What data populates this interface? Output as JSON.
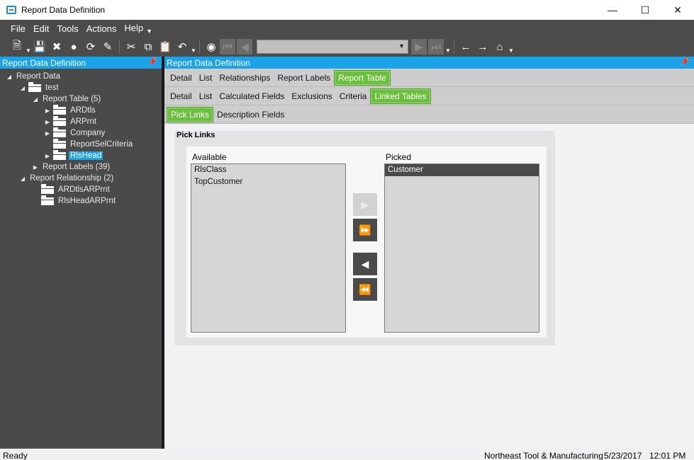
{
  "window": {
    "title": "Report Data Definition"
  },
  "menu": [
    "File",
    "Edit",
    "Tools",
    "Actions",
    "Help"
  ],
  "left_panel": {
    "title": "Report Data Definition",
    "tree": [
      {
        "label": "Report Data",
        "depth": 0,
        "expander": "expanded",
        "folder": false
      },
      {
        "label": "test",
        "depth": 1,
        "expander": "expanded",
        "folder": true
      },
      {
        "label": "Report Table (5)",
        "depth": 2,
        "expander": "expanded",
        "folder": false
      },
      {
        "label": "ARDtls",
        "depth": 3,
        "expander": "collapsed",
        "folder": true
      },
      {
        "label": "ARPrnt",
        "depth": 3,
        "expander": "collapsed",
        "folder": true
      },
      {
        "label": "Company",
        "depth": 3,
        "expander": "collapsed",
        "folder": true
      },
      {
        "label": "ReportSelCriteria",
        "depth": 3,
        "expander": "none",
        "folder": true
      },
      {
        "label": "RlsHead",
        "depth": 3,
        "expander": "collapsed",
        "folder": true,
        "selected": true
      },
      {
        "label": "Report Labels (39)",
        "depth": 2,
        "expander": "collapsed",
        "folder": false
      },
      {
        "label": "Report Relationship (2)",
        "depth": 1,
        "expander": "expanded",
        "folder": false
      },
      {
        "label": "ARDtlsARPrnt",
        "depth": 2,
        "expander": "none",
        "folder": true
      },
      {
        "label": "RlsHeadARPrnt",
        "depth": 2,
        "expander": "none",
        "folder": true
      }
    ]
  },
  "right_panel": {
    "title": "Report Data Definition",
    "tabs_level1": [
      {
        "label": "Detail"
      },
      {
        "label": "List"
      },
      {
        "label": "Relationships"
      },
      {
        "label": "Report Labels"
      },
      {
        "label": "Report Table",
        "active": true
      }
    ],
    "tabs_level2": [
      {
        "label": "Detail"
      },
      {
        "label": "List"
      },
      {
        "label": "Calculated Fields"
      },
      {
        "label": "Exclusions"
      },
      {
        "label": "Criteria"
      },
      {
        "label": "Linked Tables",
        "active": true
      }
    ],
    "tabs_level3": [
      {
        "label": "Pick Links",
        "active": true
      },
      {
        "label": "Description Fields"
      }
    ],
    "pick_links": {
      "group_title": "Pick Links",
      "available_label": "Available",
      "picked_label": "Picked",
      "available": [
        "RlsClass",
        "TopCustomer"
      ],
      "picked": [
        "Customer"
      ],
      "picked_selected_index": 0
    }
  },
  "status": {
    "left": "Ready",
    "company": "Northeast Tool & Manufacturing",
    "date": "5/23/2017",
    "time": "12:01 PM"
  },
  "colors": {
    "accent_blue": "#1aa3e8",
    "active_tab_green": "#6abf3c",
    "dark_chrome": "#4b4b4b"
  }
}
